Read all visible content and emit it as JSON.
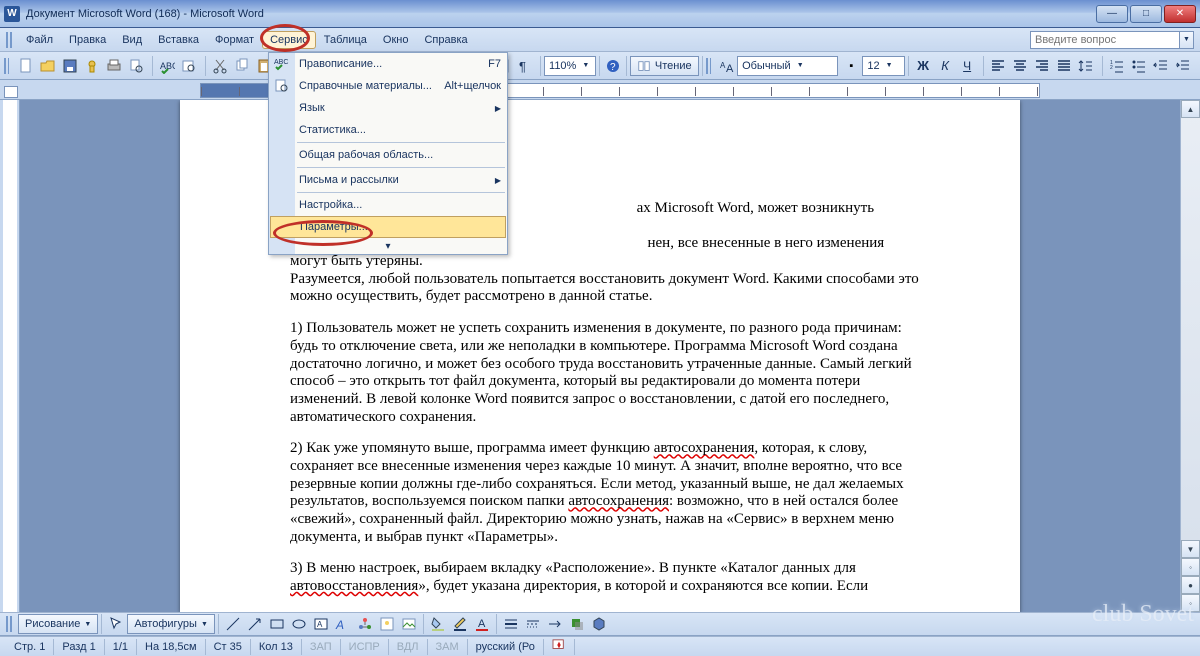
{
  "window": {
    "title": "Документ Microsoft Word (168) - Microsoft Word"
  },
  "menubar": {
    "items": [
      "Файл",
      "Правка",
      "Вид",
      "Вставка",
      "Формат",
      "Сервис",
      "Таблица",
      "Окно",
      "Справка"
    ],
    "active_index": 5,
    "question_placeholder": "Введите вопрос"
  },
  "dropdown": {
    "items": [
      {
        "label": "Правописание...",
        "shortcut": "F7",
        "icon": "spellcheck-icon"
      },
      {
        "label": "Справочные материалы...",
        "shortcut": "Alt+щелчок",
        "icon": "research-icon"
      },
      {
        "label": "Язык",
        "submenu": true
      },
      {
        "label": "Статистика..."
      },
      {
        "label": "Общая рабочая область..."
      },
      {
        "label": "Письма и рассылки",
        "submenu": true
      },
      {
        "label": "Настройка..."
      },
      {
        "label": "Параметры...",
        "highlight": true
      }
    ]
  },
  "toolbar": {
    "zoom": "110%",
    "reading_label": "Чтение",
    "style": "Обычный",
    "font_size": "12"
  },
  "statusbar": {
    "page_label": "Стр. 1",
    "section_label": "Разд 1",
    "pages": "1/1",
    "at": "На 18,5см",
    "ln": "Ст 35",
    "col": "Кол 13",
    "zap": "ЗАП",
    "ispr": "ИСПР",
    "vdl": "ВДЛ",
    "zam": "ЗАМ",
    "lang": "русский (Ро"
  },
  "drawbar": {
    "draw_label": "Рисование",
    "autoshapes_label": "Автофигуры"
  },
  "document": {
    "p1a": "ах Microsoft Word, может возникнуть неожиданная проблема:",
    "p1b": "нен, все внесенные в него изменения могут быть утеряны.",
    "p1c": "Разумеется, любой пользователь попытается восстановить документ Word. Какими способами это можно осуществить, будет рассмотрено в данной статье.",
    "p2": "1) Пользователь может не успеть сохранить изменения в документе, по разного рода причинам: будь то отключение света, или же неполадки в компьютере. Программа Microsoft Word создана достаточно логично, и может без особого труда восстановить утраченные данные. Самый легкий способ – это открыть тот файл документа, который вы редактировали до момента потери изменений. В левой колонке Word появится запрос о восстановлении, с датой его последнего, автоматического сохранения.",
    "p3_a": "2) Как уже упомянуто выше, программа имеет функцию ",
    "p3_w1": "автосохранения",
    "p3_b": ", которая, к слову, сохраняет все внесенные изменения через каждые 10 минут. А значит, вполне вероятно, что все резервные копии должны где-либо сохраняться. Если метод, указанный выше, не дал желаемых результатов, воспользуемся поиском папки ",
    "p3_w2": "автосохранения",
    "p3_c": ": возможно, что в ней остался более «свежий», сохраненный файл. Директорию можно узнать, нажав на «Сервис» в верхнем меню документа, и выбрав пункт «Параметры».",
    "p4_a": "3) В меню настроек, выбираем вкладку «Расположение». В пункте «Каталог данных для ",
    "p4_w1": "автовосстановления",
    "p4_b": "», будет указана директория, в которой и сохраняются все копии. Если"
  },
  "watermark": "club Sovet"
}
